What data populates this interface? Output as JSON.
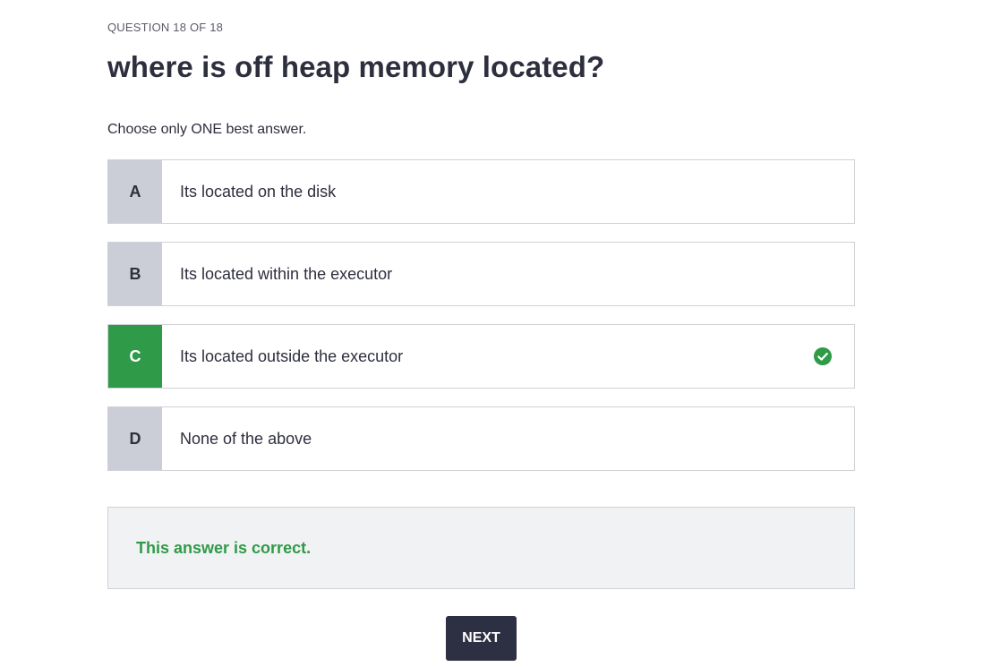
{
  "quiz": {
    "counter": "QUESTION 18 OF 18",
    "question": "where is off heap memory located?",
    "instruction": "Choose only ONE best answer.",
    "options": [
      {
        "letter": "A",
        "text": "Its located on the disk",
        "correct": false
      },
      {
        "letter": "B",
        "text": "Its located within the executor",
        "correct": false
      },
      {
        "letter": "C",
        "text": "Its located outside the executor",
        "correct": true
      },
      {
        "letter": "D",
        "text": "None of the above",
        "correct": false
      }
    ],
    "feedback": "This answer is correct.",
    "next_label": "NEXT"
  },
  "colors": {
    "correct_green": "#2f9a48",
    "letter_gray": "#cbced6",
    "text_dark": "#2d2f3e",
    "button_dark": "#2d2f42",
    "feedback_bg": "#f1f2f4"
  },
  "icons": {
    "correct_marker": "check-circle-icon"
  }
}
